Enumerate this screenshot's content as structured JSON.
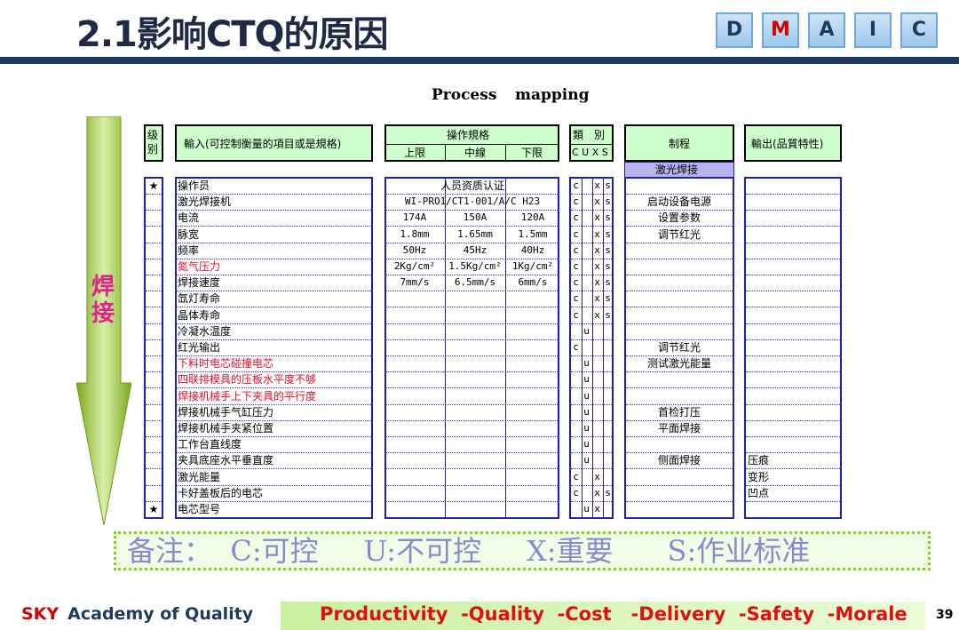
{
  "slide": {
    "title": "2.1影响CTQ的原因",
    "dmaic": [
      {
        "letter": "D",
        "active": false
      },
      {
        "letter": "M",
        "active": true
      },
      {
        "letter": "A",
        "active": false
      },
      {
        "letter": "I",
        "active": false
      },
      {
        "letter": "C",
        "active": false
      }
    ]
  },
  "process_mapping": {
    "title_left": "Process",
    "title_right": "mapping",
    "arrow_label": "焊接",
    "headers": {
      "level": "级别",
      "input": "輸入(可控制衡量的項目或是規格)",
      "spec": "操作規格",
      "spec_upper": "上限",
      "spec_mid": "中線",
      "spec_lower": "下限",
      "category": "類　別",
      "category_cols": "C U X S",
      "process": "制程",
      "process_step": "激光焊接",
      "output": "輸出(品質特性)"
    },
    "rows": [
      {
        "star": "★",
        "input": "操作员",
        "red": false,
        "spec_full": "人员资质认证",
        "c": "c",
        "u": "",
        "x": "x",
        "s": "s",
        "process": "",
        "output": ""
      },
      {
        "star": "",
        "input": "激光焊接机",
        "red": false,
        "spec_full": "WI-PRO1/CT1-001/A/C H23",
        "c": "c",
        "u": "",
        "x": "x",
        "s": "s",
        "process": "启动设备电源",
        "output": ""
      },
      {
        "star": "",
        "input": "电流",
        "red": false,
        "upper": "174A",
        "mid": "150A",
        "lower": "120A",
        "c": "c",
        "u": "",
        "x": "x",
        "s": "s",
        "process": "设置参数",
        "output": ""
      },
      {
        "star": "",
        "input": "脉宽",
        "red": false,
        "upper": "1.8mm",
        "mid": "1.65mm",
        "lower": "1.5mm",
        "c": "c",
        "u": "",
        "x": "x",
        "s": "s",
        "process": "调节红光",
        "output": ""
      },
      {
        "star": "",
        "input": "频率",
        "red": false,
        "upper": "50Hz",
        "mid": "45Hz",
        "lower": "40Hz",
        "c": "c",
        "u": "",
        "x": "x",
        "s": "s",
        "process": "",
        "output": ""
      },
      {
        "star": "",
        "input": "氮气压力",
        "red": true,
        "upper": "2Kg/cm²",
        "mid": "1.5Kg/cm²",
        "lower": "1Kg/cm²",
        "c": "c",
        "u": "",
        "x": "x",
        "s": "s",
        "process": "",
        "output": ""
      },
      {
        "star": "",
        "input": "焊接速度",
        "red": false,
        "upper": "7mm/s",
        "mid": "6.5mm/s",
        "lower": "6mm/s",
        "c": "c",
        "u": "",
        "x": "x",
        "s": "s",
        "process": "",
        "output": ""
      },
      {
        "star": "",
        "input": "氙灯寿命",
        "red": false,
        "c": "c",
        "u": "",
        "x": "x",
        "s": "s",
        "process": "",
        "output": ""
      },
      {
        "star": "",
        "input": "晶体寿命",
        "red": false,
        "c": "c",
        "u": "",
        "x": "x",
        "s": "s",
        "process": "",
        "output": ""
      },
      {
        "star": "",
        "input": "冷凝水温度",
        "red": false,
        "c": "",
        "u": "u",
        "x": "",
        "s": "",
        "process": "",
        "output": ""
      },
      {
        "star": "",
        "input": "红光输出",
        "red": false,
        "c": "c",
        "u": "",
        "x": "",
        "s": "",
        "process": "调节红光",
        "output": ""
      },
      {
        "star": "",
        "input": "下料时电芯碰撞电芯",
        "red": true,
        "c": "",
        "u": "u",
        "x": "",
        "s": "",
        "process": "测试激光能量",
        "output": ""
      },
      {
        "star": "",
        "input": "四联排模具的压板水平度不够",
        "red": true,
        "c": "",
        "u": "u",
        "x": "",
        "s": "",
        "process": "",
        "output": ""
      },
      {
        "star": "",
        "input": "焊接机械手上下夹具的平行度",
        "red": true,
        "c": "",
        "u": "u",
        "x": "",
        "s": "",
        "process": "",
        "output": ""
      },
      {
        "star": "",
        "input": "焊接机械手气缸压力",
        "red": false,
        "c": "",
        "u": "u",
        "x": "",
        "s": "",
        "process": "首检打压",
        "output": ""
      },
      {
        "star": "",
        "input": "焊接机械手夹紧位置",
        "red": false,
        "c": "",
        "u": "u",
        "x": "",
        "s": "",
        "process": "平面焊接",
        "output": ""
      },
      {
        "star": "",
        "input": "工作台直线度",
        "red": false,
        "c": "",
        "u": "u",
        "x": "",
        "s": "",
        "process": "",
        "output": ""
      },
      {
        "star": "",
        "input": "夹具底座水平垂直度",
        "red": false,
        "c": "",
        "u": "u",
        "x": "",
        "s": "",
        "process": "侧面焊接",
        "output": "压痕"
      },
      {
        "star": "",
        "input": "激光能量",
        "red": false,
        "c": "c",
        "u": "",
        "x": "x",
        "s": "",
        "process": "",
        "output": "变形"
      },
      {
        "star": "",
        "input": "卡好盖板后的电芯",
        "red": false,
        "c": "c",
        "u": "",
        "x": "x",
        "s": "s",
        "process": "",
        "output": "凹点"
      },
      {
        "star": "★",
        "input": "电芯型号",
        "red": false,
        "c": "",
        "u": "u",
        "x": "x",
        "s": "",
        "process": "",
        "output": ""
      }
    ]
  },
  "note": {
    "text": "备注：  C:可控     U:不可控     X:重要      S:作业标准"
  },
  "footer": {
    "org_a": "SKY",
    "org_b": "Academy of Quality",
    "motto": "Productivity  -Quality  -Cost   -Delivery  -Safety  -Morale",
    "page": "39"
  }
}
